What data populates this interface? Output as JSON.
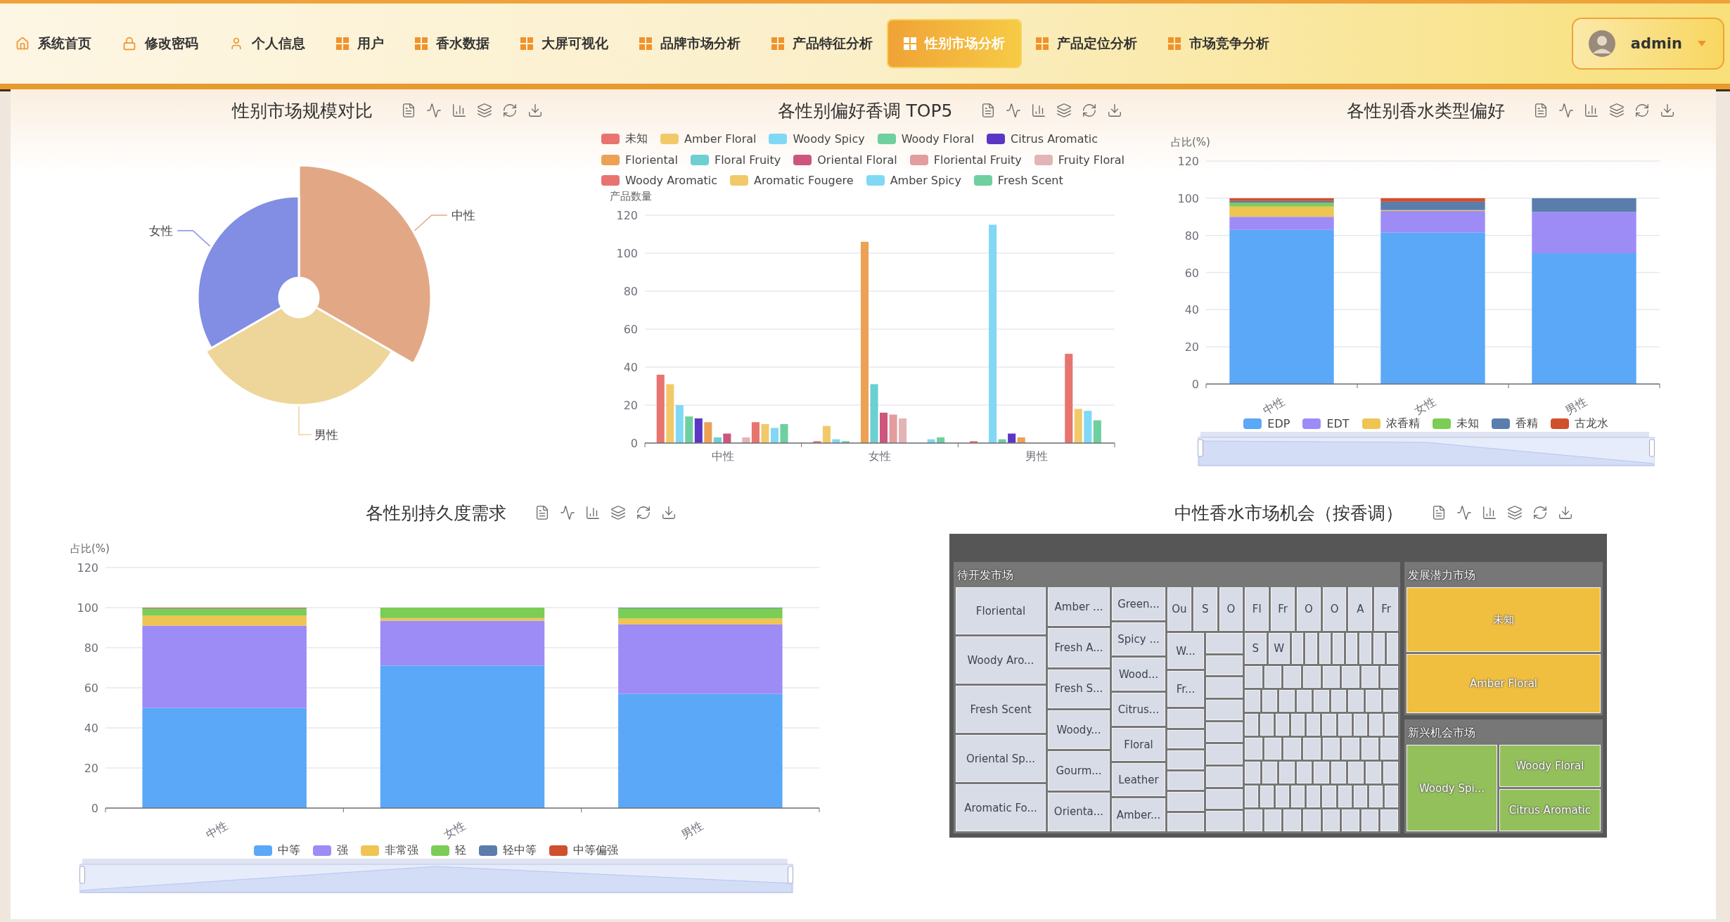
{
  "nav": {
    "items": [
      {
        "label": "系统首页",
        "kind": "home",
        "selected": false
      },
      {
        "label": "修改密码",
        "kind": "lock",
        "selected": false
      },
      {
        "label": "个人信息",
        "kind": "user",
        "selected": false
      },
      {
        "label": "用户",
        "kind": "grid",
        "selected": false
      },
      {
        "label": "香水数据",
        "kind": "grid",
        "selected": false
      },
      {
        "label": "大屏可视化",
        "kind": "grid",
        "selected": false
      },
      {
        "label": "品牌市场分析",
        "kind": "grid",
        "selected": false
      },
      {
        "label": "产品特征分析",
        "kind": "grid",
        "selected": false
      },
      {
        "label": "性别市场分析",
        "kind": "grid",
        "selected": true
      },
      {
        "label": "产品定位分析",
        "kind": "grid",
        "selected": false
      },
      {
        "label": "市场竞争分析",
        "kind": "grid",
        "selected": false
      }
    ],
    "user": {
      "name": "admin"
    }
  },
  "gender_scale": {
    "title": "性别市场规模对比",
    "slices": [
      {
        "label": "中性",
        "color": "#e2a886"
      },
      {
        "label": "男性",
        "color": "#eed599"
      },
      {
        "label": "女性",
        "color": "#818ee3"
      }
    ]
  },
  "scent_top5": {
    "title": "各性别偏好香调 TOP5",
    "chart_data": {
      "type": "bar",
      "grid": true,
      "ylabel": "产品数量",
      "categories": [
        "中性",
        "女性",
        "男性"
      ],
      "ylim": [
        0,
        120
      ],
      "yticks": [
        0,
        20,
        40,
        60,
        80,
        100,
        120
      ],
      "series": [
        {
          "name": "未知",
          "color": "#e87470",
          "values": [
            36,
            1,
            1
          ]
        },
        {
          "name": "Amber Floral",
          "color": "#f2c96a",
          "values": [
            31,
            9,
            0
          ]
        },
        {
          "name": "Woody Spicy",
          "color": "#80d8f5",
          "values": [
            20,
            2,
            115
          ]
        },
        {
          "name": "Woody Floral",
          "color": "#6ecf9f",
          "values": [
            14,
            1,
            2
          ]
        },
        {
          "name": "Citrus Aromatic",
          "color": "#5b36c5",
          "values": [
            13,
            0,
            5
          ]
        },
        {
          "name": "Floriental",
          "color": "#eda155",
          "values": [
            11,
            106,
            3
          ]
        },
        {
          "name": "Floral Fruity",
          "color": "#6ccfd1",
          "values": [
            3,
            31,
            0
          ]
        },
        {
          "name": "Oriental Floral",
          "color": "#cc567c",
          "values": [
            5,
            16,
            0
          ]
        },
        {
          "name": "Floriental Fruity",
          "color": "#e29d9c",
          "values": [
            0,
            15,
            0
          ]
        },
        {
          "name": "Fruity Floral",
          "color": "#e2b4b6",
          "values": [
            3,
            13,
            0
          ]
        },
        {
          "name": "Woody Aromatic",
          "color": "#e87470",
          "values": [
            11,
            0,
            47
          ]
        },
        {
          "name": "Aromatic Fougere",
          "color": "#f2c96a",
          "values": [
            10,
            0,
            18
          ]
        },
        {
          "name": "Amber Spicy",
          "color": "#80d8f5",
          "values": [
            8,
            2,
            17
          ]
        },
        {
          "name": "Fresh Scent",
          "color": "#6ecf9f",
          "values": [
            10,
            3,
            12
          ]
        }
      ]
    }
  },
  "type_pref": {
    "title": "各性别香水类型偏好",
    "zoom_slider": {
      "level": 1
    },
    "chart_data": {
      "type": "bar",
      "grid": true,
      "stacked": true,
      "ylabel": "占比(%)",
      "categories": [
        "中性",
        "女性",
        "男性"
      ],
      "ylim": [
        0,
        120
      ],
      "yticks": [
        0,
        20,
        40,
        60,
        80,
        100,
        120
      ],
      "series": [
        {
          "name": "EDP",
          "color": "#5aa8f7",
          "values": [
            83,
            81.5,
            70.4
          ]
        },
        {
          "name": "EDT",
          "color": "#9d8bf6",
          "values": [
            7,
            11.6,
            22.2
          ]
        },
        {
          "name": "浓香精",
          "color": "#efc452",
          "values": [
            5.5,
            0.5,
            0
          ]
        },
        {
          "name": "未知",
          "color": "#7bcd55",
          "values": [
            2,
            0,
            0
          ]
        },
        {
          "name": "香精",
          "color": "#5a7dab",
          "values": [
            1,
            4.5,
            7.4
          ]
        },
        {
          "name": "古龙水",
          "color": "#d04f2d",
          "values": [
            1.5,
            1.9,
            0
          ]
        }
      ]
    }
  },
  "longevity": {
    "title": "各性别持久度需求",
    "zoom_slider": {
      "level": 1
    },
    "chart_data": {
      "type": "bar",
      "grid": true,
      "stacked": true,
      "ylabel": "占比(%)",
      "categories": [
        "中性",
        "女性",
        "男性"
      ],
      "ylim": [
        0,
        120
      ],
      "yticks": [
        0,
        20,
        40,
        60,
        80,
        100,
        120
      ],
      "series": [
        {
          "name": "中等",
          "color": "#5aa8f7",
          "values": [
            50,
            71.1,
            57
          ]
        },
        {
          "name": "强",
          "color": "#9d8bf6",
          "values": [
            41,
            22.4,
            34.6
          ]
        },
        {
          "name": "非常强",
          "color": "#efc452",
          "values": [
            5,
            1.3,
            3
          ]
        },
        {
          "name": "轻",
          "color": "#7bcd55",
          "values": [
            3.5,
            5.2,
            5.1
          ]
        },
        {
          "name": "轻中等",
          "color": "#5a7dab",
          "values": [
            0.2,
            0,
            0.3
          ]
        },
        {
          "name": "中等偏强",
          "color": "#d04f2d",
          "values": [
            0.3,
            0,
            0
          ]
        }
      ]
    }
  },
  "market_map": {
    "title": "中性香水市场机会（按香调）",
    "groups": [
      {
        "title": "待开发市场",
        "kind": "dense",
        "color": "#d8dce6",
        "columns": [
          [
            "Floriental",
            "Woody Aro...",
            "Fresh Scent",
            "Oriental Sp...",
            "Aromatic Fo..."
          ],
          [
            "Amber ...",
            "Fresh A...",
            "Fresh S...",
            "Woody...",
            "Gourm...",
            "Orienta..."
          ],
          [
            "Green...",
            "Spicy ...",
            "Wood...",
            "Citrus...",
            "Floral",
            "Leather",
            "Amber..."
          ]
        ],
        "small_row": [
          "Ou",
          "S",
          "O",
          "Fl",
          "Fr",
          "O",
          "O",
          "A",
          "Fr"
        ],
        "small_column": [
          "W...",
          "Fr..."
        ],
        "small_pair": [
          "S",
          "W"
        ]
      },
      {
        "title": "发展潜力市场",
        "kind": "stack",
        "color": "#f0bf40",
        "tiles": [
          "未知",
          "Amber Floral"
        ]
      },
      {
        "title": "新兴机会市场",
        "kind": "split",
        "color": "#94c05c",
        "tiles": [
          "Woody Spi...",
          "Woody Floral",
          "Citrus Aromatic"
        ]
      }
    ]
  }
}
